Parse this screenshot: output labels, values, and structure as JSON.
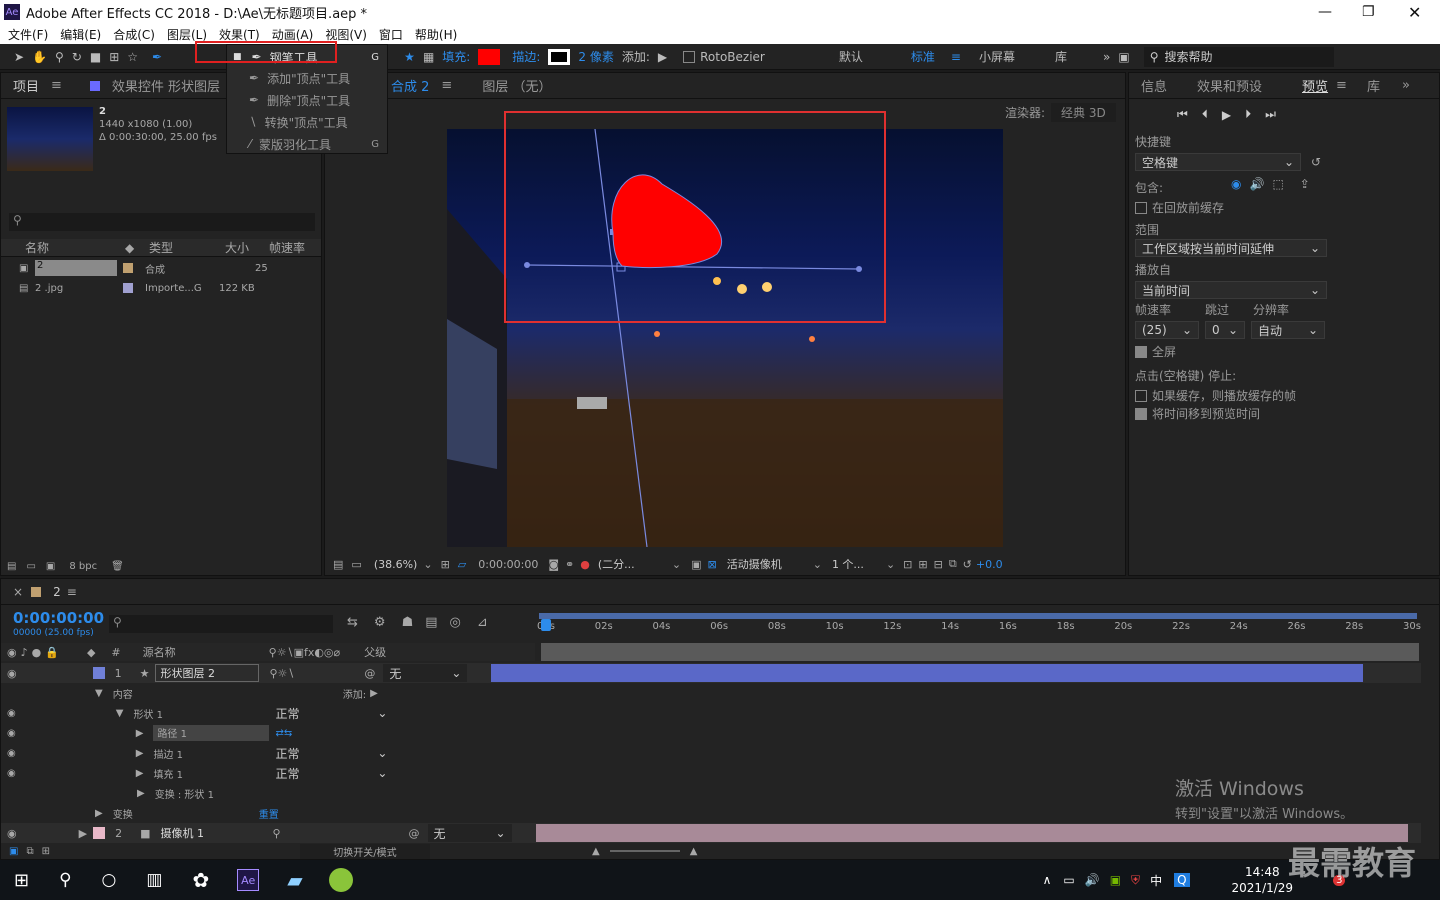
{
  "app": {
    "logo": "Ae",
    "title": "Adobe After Effects CC 2018 - D:\\Ae\\无标题项目.aep *"
  },
  "menu": [
    "文件(F)",
    "编辑(E)",
    "合成(C)",
    "图层(L)",
    "效果(T)",
    "动画(A)",
    "视图(V)",
    "窗口",
    "帮助(H)"
  ],
  "toolbar": {
    "fill": "填充:",
    "stroke": "描边:",
    "stroke_px": "2 像素",
    "add": "添加:",
    "roto": "RotoBezier",
    "ws": [
      "默认",
      "标准",
      "小屏幕",
      "库"
    ],
    "search": "搜索帮助",
    "shortcut": "G",
    "fill_color": "#ff0000"
  },
  "pen_menu": [
    {
      "label": "钢笔工具",
      "key": "G"
    },
    {
      "label": "添加\"顶点\"工具",
      "key": ""
    },
    {
      "label": "删除\"顶点\"工具",
      "key": ""
    },
    {
      "label": "转换\"顶点\"工具",
      "key": ""
    },
    {
      "label": "蒙版羽化工具",
      "key": "G"
    }
  ],
  "project": {
    "tab": "项目",
    "tab2": "效果控件 形状图层",
    "item_name": "2",
    "item_dims": "1440 x1080 (1.00)",
    "item_dur": "Δ 0:00:30:00, 25.00 fps",
    "cols": [
      "名称",
      "类型",
      "大小",
      "帧速率"
    ],
    "rows": [
      {
        "name": "2",
        "type": "合成",
        "size": "",
        "fps": "25"
      },
      {
        "name": "2 .jpg",
        "type": "Importe...G",
        "size": "122 KB",
        "fps": ""
      }
    ],
    "bpc": "8 bpc"
  },
  "comp": {
    "tab": "合成 2",
    "tab2": "图层 （无）",
    "renderer_label": "渲染器:",
    "renderer": "经典 3D",
    "zoom": "(38.6%)",
    "time": "0:00:00:00",
    "quality": "(二分...",
    "camera": "活动摄像机",
    "views": "1 个...",
    "exposure": "+0.0"
  },
  "right": {
    "tabs": [
      "信息",
      "效果和预设",
      "预览",
      "库"
    ],
    "shortcut_label": "快捷键",
    "shortcut": "空格键",
    "include": "包含:",
    "cache": "在回放前缓存",
    "range_label": "范围",
    "range": "工作区域按当前时间延伸",
    "play_from_label": "播放自",
    "play_from": "当前时间",
    "fps_label": "帧速率",
    "skip_label": "跳过",
    "res_label": "分辨率",
    "fps": "(25)",
    "skip": "0",
    "res": "自动",
    "fullscreen": "全屏",
    "stop_label": "点击(空格键) 停止:",
    "opt1": "如果缓存，则播放缓存的帧",
    "opt2": "将时间移到预览时间"
  },
  "timeline": {
    "tab": "2",
    "timecode": "0:00:00:00",
    "fps": "00000 (25.00 fps)",
    "cols": [
      "源名称",
      "父级"
    ],
    "ticks": [
      "00s",
      "02s",
      "04s",
      "06s",
      "08s",
      "10s",
      "12s",
      "14s",
      "16s",
      "18s",
      "20s",
      "22s",
      "24s",
      "26s",
      "28s",
      "30s"
    ],
    "layers": [
      {
        "num": "1",
        "name": "形状图层 2",
        "parent": "无"
      },
      {
        "num": "2",
        "name": "摄像机 1",
        "parent": "无"
      }
    ],
    "props": {
      "content": "内容",
      "add": "添加:",
      "shape": "形状 1",
      "path": "路径 1",
      "stroke": "描边 1",
      "fill": "填充 1",
      "xform": "变换 : 形状 1",
      "transform": "变换",
      "reset": "重置",
      "normal": "正常"
    },
    "toggle": "切换开关/模式"
  },
  "watermark": {
    "line1": "激活 Windows",
    "line2": "转到\"设置\"以激活 Windows。",
    "brand": "最需教育"
  },
  "taskbar": {
    "time": "14:48",
    "date": "2021/1/29",
    "ime": "中",
    "badge": "3"
  }
}
